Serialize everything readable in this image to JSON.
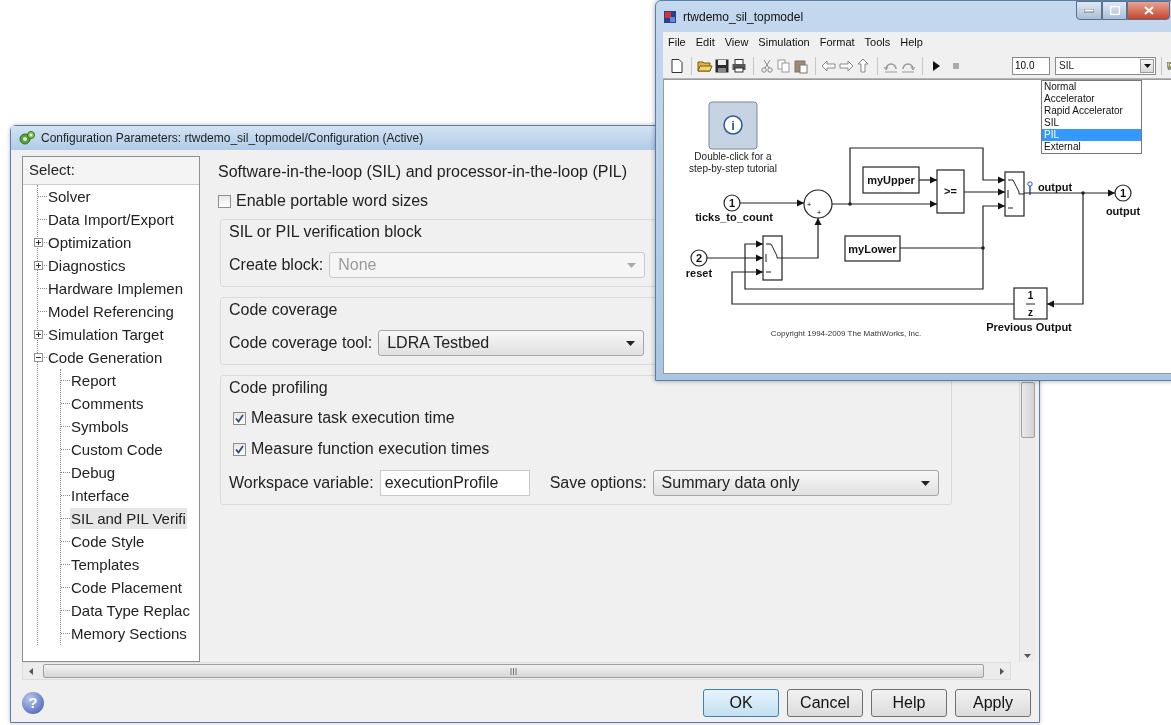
{
  "config_window": {
    "title": "Configuration Parameters: rtwdemo_sil_topmodel/Configuration (Active)",
    "tree": {
      "header": "Select:",
      "items": [
        {
          "label": "Solver",
          "kind": "leaf",
          "selected": false
        },
        {
          "label": "Data Import/Export",
          "kind": "leaf",
          "selected": false
        },
        {
          "label": "Optimization",
          "kind": "folder",
          "expanded": false,
          "selected": false
        },
        {
          "label": "Diagnostics",
          "kind": "folder",
          "expanded": false,
          "selected": false
        },
        {
          "label": "Hardware Implemen",
          "kind": "leaf",
          "selected": false
        },
        {
          "label": "Model Referencing",
          "kind": "leaf",
          "selected": false
        },
        {
          "label": "Simulation Target",
          "kind": "folder",
          "expanded": false,
          "selected": false
        },
        {
          "label": "Code Generation",
          "kind": "folder",
          "expanded": true,
          "selected": false,
          "children": [
            {
              "label": "Report",
              "kind": "leaf",
              "selected": false
            },
            {
              "label": "Comments",
              "kind": "leaf",
              "selected": false
            },
            {
              "label": "Symbols",
              "kind": "leaf",
              "selected": false
            },
            {
              "label": "Custom Code",
              "kind": "leaf",
              "selected": false
            },
            {
              "label": "Debug",
              "kind": "leaf",
              "selected": false
            },
            {
              "label": "Interface",
              "kind": "leaf",
              "selected": false
            },
            {
              "label": "SIL and PIL Verifi",
              "kind": "leaf",
              "selected": true
            },
            {
              "label": "Code Style",
              "kind": "leaf",
              "selected": false
            },
            {
              "label": "Templates",
              "kind": "leaf",
              "selected": false
            },
            {
              "label": "Code Placement",
              "kind": "leaf",
              "selected": false
            },
            {
              "label": "Data Type Replac",
              "kind": "leaf",
              "selected": false
            },
            {
              "label": "Memory Sections",
              "kind": "leaf",
              "selected": false
            }
          ]
        }
      ]
    },
    "panel": {
      "title": "Software-in-the-loop (SIL) and processor-in-the-loop (PIL)",
      "portable_word_sizes": {
        "label": "Enable portable word sizes",
        "checked": false
      },
      "groups": [
        {
          "title": "SIL or PIL verification block",
          "rows": [
            {
              "kind": "select",
              "label": "Create block:",
              "value": "None",
              "disabled": true
            }
          ]
        },
        {
          "title": "Code coverage",
          "rows": [
            {
              "kind": "select",
              "label": "Code coverage tool:",
              "value": "LDRA Testbed",
              "disabled": false
            }
          ]
        },
        {
          "title": "Code profiling",
          "rows": [
            {
              "kind": "checkbox",
              "label": "Measure task execution time",
              "checked": true
            },
            {
              "kind": "checkbox",
              "label": "Measure function execution times",
              "checked": true
            },
            {
              "kind": "fields",
              "fields": [
                {
                  "kind": "input",
                  "label": "Workspace variable:",
                  "value": "executionProfile"
                },
                {
                  "kind": "select",
                  "label": "Save options:",
                  "value": "Summary data only",
                  "disabled": false
                }
              ]
            }
          ]
        }
      ]
    },
    "help_symbol": "?",
    "buttons": [
      {
        "label": "OK",
        "default": true
      },
      {
        "label": "Cancel",
        "default": false
      },
      {
        "label": "Help",
        "default": false
      },
      {
        "label": "Apply",
        "default": false
      }
    ]
  },
  "model_window": {
    "title": "rtwdemo_sil_topmodel",
    "menu": [
      "File",
      "Edit",
      "View",
      "Simulation",
      "Format",
      "Tools",
      "Help"
    ],
    "toolbar": {
      "stop_time": "10.0",
      "mode": "SIL",
      "mode_menu": [
        {
          "label": "Normal",
          "selected": false
        },
        {
          "label": "Accelerator",
          "selected": false
        },
        {
          "label": "Rapid Accelerator",
          "selected": false
        },
        {
          "label": "SIL",
          "selected": false
        },
        {
          "label": "PIL",
          "selected": true
        },
        {
          "label": "External",
          "selected": false
        }
      ]
    },
    "diagram": {
      "tutorial": {
        "symbol": "i",
        "caption_lines": [
          "Double-click for a",
          "step-by-step tutorial"
        ]
      },
      "inports": [
        {
          "number": "1",
          "name": "ticks_to_count"
        },
        {
          "number": "2",
          "name": "reset"
        }
      ],
      "sum_signs": [
        "+",
        "+"
      ],
      "constants": [
        "myUpper",
        "myLower"
      ],
      "operator": ">=",
      "signal_label": "output",
      "outport": {
        "number": "1",
        "name": "output"
      },
      "delay": {
        "numerator": "1",
        "denominator": "z",
        "name": "Previous Output"
      },
      "copyright": "Copyright 1994-2009 The MathWorks, Inc."
    }
  }
}
